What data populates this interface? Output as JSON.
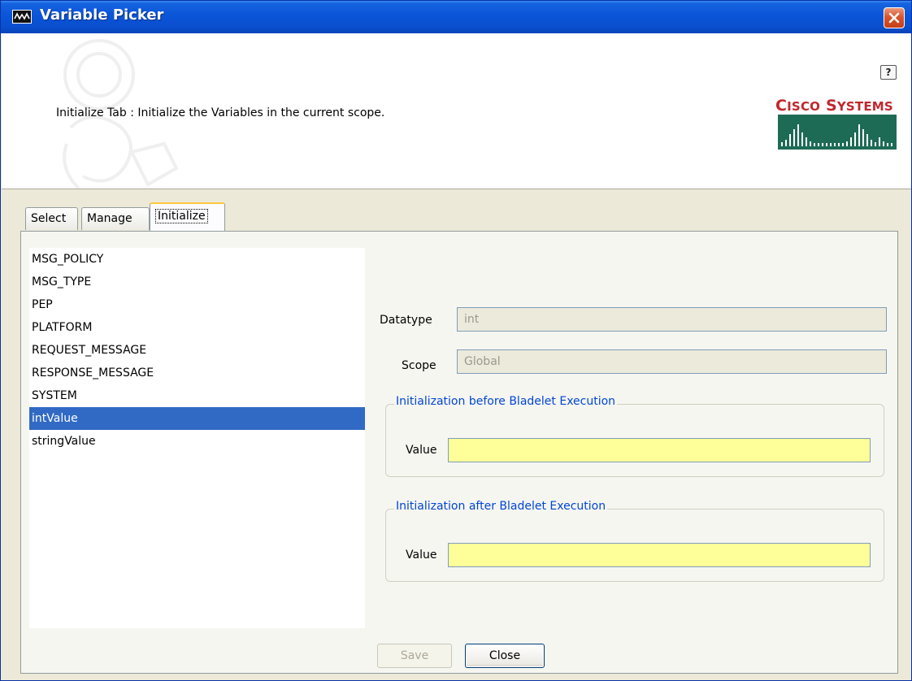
{
  "window": {
    "title": "Variable Picker"
  },
  "header": {
    "description": "Initialize Tab : Initialize the Variables in the current scope.",
    "help_label": "?",
    "brand_name_big_1": "C",
    "brand_name_small_1": "ISCO",
    "brand_name_big_2": "S",
    "brand_name_small_2": "YSTEMS"
  },
  "tabs": [
    {
      "label": "Select",
      "active": false
    },
    {
      "label": "Manage",
      "active": false
    },
    {
      "label": "Initialize",
      "active": true
    }
  ],
  "variables": [
    "MSG_POLICY",
    "MSG_TYPE",
    "PEP",
    "PLATFORM",
    "REQUEST_MESSAGE",
    "RESPONSE_MESSAGE",
    "SYSTEM",
    "intValue",
    "stringValue"
  ],
  "selected_variable": "intValue",
  "details": {
    "datatype_label": "Datatype",
    "datatype_value": "int",
    "scope_label": "Scope",
    "scope_value": "Global"
  },
  "init_before": {
    "title": "Initialization before Bladelet Execution",
    "value_label": "Value",
    "value": ""
  },
  "init_after": {
    "title": "Initialization after Bladelet Execution",
    "value_label": "Value",
    "value": ""
  },
  "buttons": {
    "save_label": "Save",
    "save_enabled": false,
    "close_label": "Close"
  },
  "colors": {
    "title_bar": "#0a55d8",
    "brand_red": "#c1272d",
    "brand_bars": "#1d6b55",
    "selection": "#316ac5",
    "value_field": "#ffff99",
    "group_title": "#0046d5"
  }
}
